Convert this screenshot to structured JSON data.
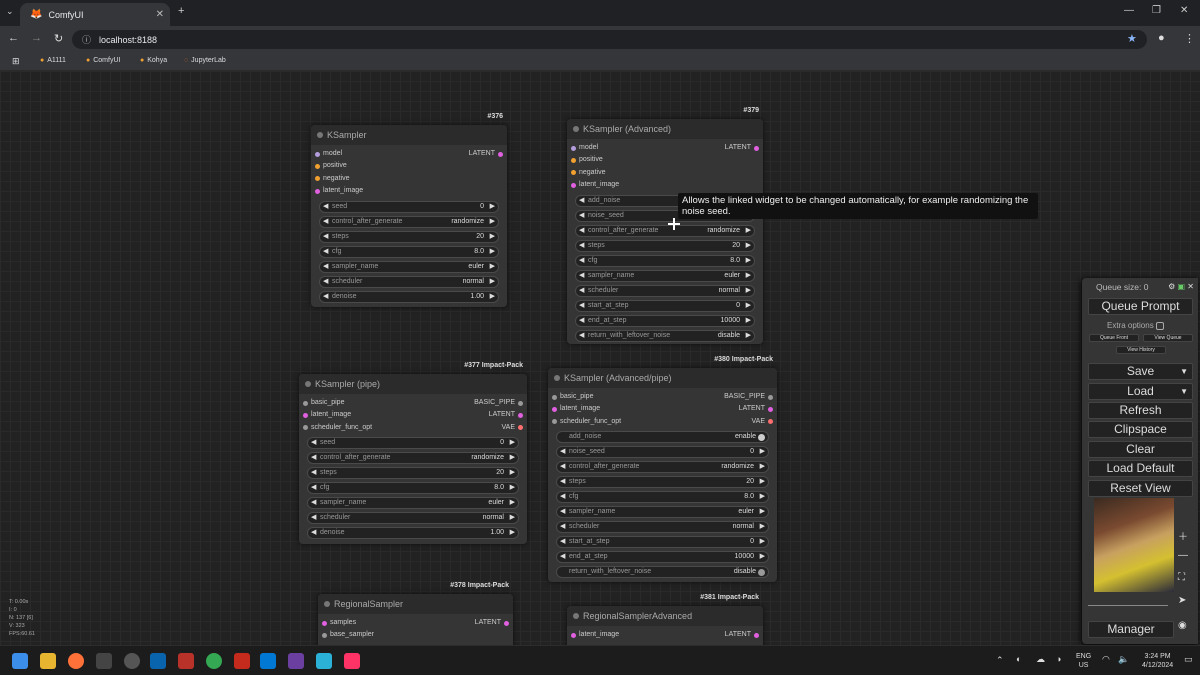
{
  "browser": {
    "tab_title": "ComfyUI",
    "address": "localhost:8188",
    "bookmarks": [
      "A1111",
      "ComfyUI",
      "Kohya",
      "JupyterLab"
    ]
  },
  "nodes": {
    "ks": {
      "badge": "#376",
      "title": "KSampler",
      "inputs": [
        "model",
        "positive",
        "negative",
        "latent_image"
      ],
      "output": "LATENT",
      "widgets": [
        {
          "n": "seed",
          "v": "0"
        },
        {
          "n": "control_after_generate",
          "v": "randomize"
        },
        {
          "n": "steps",
          "v": "20"
        },
        {
          "n": "cfg",
          "v": "8.0"
        },
        {
          "n": "sampler_name",
          "v": "euler"
        },
        {
          "n": "scheduler",
          "v": "normal"
        },
        {
          "n": "denoise",
          "v": "1.00"
        }
      ]
    },
    "ksa": {
      "badge": "#379",
      "title": "KSampler (Advanced)",
      "inputs": [
        "model",
        "positive",
        "negative",
        "latent_image"
      ],
      "output": "LATENT",
      "widgets": [
        {
          "n": "add_noise",
          "v": ""
        },
        {
          "n": "noise_seed",
          "v": ""
        },
        {
          "n": "control_after_generate",
          "v": "randomize"
        },
        {
          "n": "steps",
          "v": "20"
        },
        {
          "n": "cfg",
          "v": "8.0"
        },
        {
          "n": "sampler_name",
          "v": "euler"
        },
        {
          "n": "scheduler",
          "v": "normal"
        },
        {
          "n": "start_at_step",
          "v": "0"
        },
        {
          "n": "end_at_step",
          "v": "10000"
        },
        {
          "n": "return_with_leftover_noise",
          "v": "disable"
        }
      ]
    },
    "ksp": {
      "badge": "#377 Impact-Pack",
      "title": "KSampler (pipe)",
      "inputs": [
        "basic_pipe",
        "latent_image",
        "scheduler_func_opt"
      ],
      "outputs": [
        "BASIC_PIPE",
        "LATENT",
        "VAE"
      ],
      "widgets": [
        {
          "n": "seed",
          "v": "0"
        },
        {
          "n": "control_after_generate",
          "v": "randomize"
        },
        {
          "n": "steps",
          "v": "20"
        },
        {
          "n": "cfg",
          "v": "8.0"
        },
        {
          "n": "sampler_name",
          "v": "euler"
        },
        {
          "n": "scheduler",
          "v": "normal"
        },
        {
          "n": "denoise",
          "v": "1.00"
        }
      ]
    },
    "ksap": {
      "badge": "#380 Impact-Pack",
      "title": "KSampler (Advanced/pipe)",
      "inputs": [
        "basic_pipe",
        "latent_image",
        "scheduler_func_opt"
      ],
      "outputs": [
        "BASIC_PIPE",
        "LATENT",
        "VAE"
      ],
      "toggle_top": {
        "n": "add_noise",
        "v": "enable"
      },
      "widgets": [
        {
          "n": "noise_seed",
          "v": "0"
        },
        {
          "n": "control_after_generate",
          "v": "randomize"
        },
        {
          "n": "steps",
          "v": "20"
        },
        {
          "n": "cfg",
          "v": "8.0"
        },
        {
          "n": "sampler_name",
          "v": "euler"
        },
        {
          "n": "scheduler",
          "v": "normal"
        },
        {
          "n": "start_at_step",
          "v": "0"
        },
        {
          "n": "end_at_step",
          "v": "10000"
        }
      ],
      "toggle_bottom": {
        "n": "return_with_leftover_noise",
        "v": "disable"
      }
    },
    "rs": {
      "badge": "#378 Impact-Pack",
      "title": "RegionalSampler",
      "inputs": [
        "samples",
        "base_sampler"
      ],
      "output": "LATENT"
    },
    "rsa": {
      "badge": "#381 Impact-Pack",
      "title": "RegionalSamplerAdvanced",
      "inputs": [
        "latent_image"
      ],
      "output": "LATENT"
    }
  },
  "tooltip": "Allows the linked widget to be changed automatically, for example randomizing the noise seed.",
  "stats": [
    "T: 0.00s",
    "I: 0",
    "N: 137 [6]",
    "V: 323",
    "FPS:60.61"
  ],
  "menu": {
    "queue_size": "Queue size: 0",
    "queue_prompt": "Queue Prompt",
    "extra_options": "Extra options",
    "queue_front": "Queue Front",
    "view_queue": "View Queue",
    "view_history": "View History",
    "save": "Save",
    "load": "Load",
    "refresh": "Refresh",
    "clipspace": "Clipspace",
    "clear": "Clear",
    "load_default": "Load Default",
    "reset_view": "Reset View",
    "manager": "Manager"
  },
  "taskbar": {
    "lang": "ENG",
    "region": "US",
    "time": "3:24 PM",
    "date": "4/12/2024"
  }
}
